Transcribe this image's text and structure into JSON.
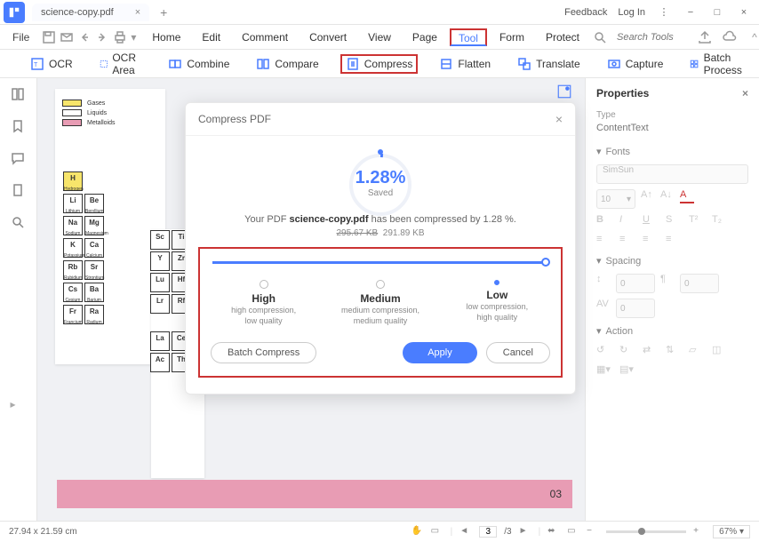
{
  "titlebar": {
    "tab_title": "science-copy.pdf",
    "feedback": "Feedback",
    "login": "Log In"
  },
  "menubar": {
    "file": "File",
    "items": [
      "Home",
      "Edit",
      "Comment",
      "Convert",
      "View",
      "Page",
      "Tool",
      "Form",
      "Protect"
    ],
    "active_index": 6,
    "search_placeholder": "Search Tools"
  },
  "toolbar": {
    "items": [
      "OCR",
      "OCR Area",
      "Combine",
      "Compare",
      "Compress",
      "Flatten",
      "Translate",
      "Capture",
      "Batch Process"
    ],
    "highlight_index": 4
  },
  "properties": {
    "title": "Properties",
    "type_label": "Type",
    "type_value": "ContentText",
    "fonts_label": "Fonts",
    "font_value": "SimSun",
    "size_value": "10",
    "spacing_label": "Spacing",
    "spacing_val1": "0",
    "spacing_val2": "0",
    "spacing_val3": "0",
    "action_label": "Action"
  },
  "statusbar": {
    "dims": "27.94 x 21.59 cm",
    "page": "3",
    "page_total": "/3",
    "zoom": "67%"
  },
  "doc": {
    "pink_num": "03",
    "legend": [
      {
        "label": "Gases",
        "color": "#f7e56b"
      },
      {
        "label": "Liquids",
        "color": "#ffffff"
      },
      {
        "label": "Metalloids",
        "color": "#e89cb4"
      }
    ]
  },
  "modal": {
    "title": "Compress PDF",
    "percent": "1.28%",
    "saved": "Saved",
    "msg_pre": "Your PDF ",
    "msg_file": "science-copy.pdf",
    "msg_post": "  has been compressed by  1.28 %.",
    "old_size": "295.67 KB",
    "new_size": "291.89 KB",
    "options": [
      {
        "title": "High",
        "desc1": "high compression,",
        "desc2": "low quality"
      },
      {
        "title": "Medium",
        "desc1": "medium compression,",
        "desc2": "medium quality"
      },
      {
        "title": "Low",
        "desc1": "low compression,",
        "desc2": "high quality"
      }
    ],
    "selected_index": 2,
    "batch_btn": "Batch Compress",
    "apply_btn": "Apply",
    "cancel_btn": "Cancel"
  }
}
